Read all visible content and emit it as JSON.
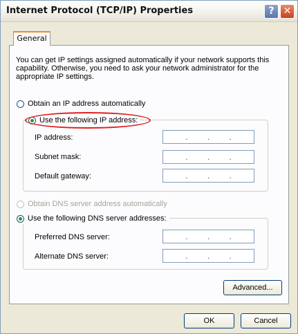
{
  "window": {
    "title": "Internet Protocol (TCP/IP) Properties",
    "help_symbol": "?",
    "close_symbol": "✕"
  },
  "tabs": [
    {
      "label": "General"
    }
  ],
  "intro_text": "You can get IP settings assigned automatically if your network supports this capability. Otherwise, you need to ask your network administrator for the appropriate IP settings.",
  "ip_options": {
    "auto": {
      "label": "Obtain an IP address automatically",
      "checked": false
    },
    "manual": {
      "label": "Use the following IP address:",
      "checked": true
    }
  },
  "ip_fields": [
    {
      "label": "IP address:",
      "value": ". . ."
    },
    {
      "label": "Subnet mask:",
      "value": ". . ."
    },
    {
      "label": "Default gateway:",
      "value": ". . ."
    }
  ],
  "dns_options": {
    "auto": {
      "label": "Obtain DNS server address automatically",
      "checked": false,
      "disabled": true
    },
    "manual": {
      "label": "Use the following DNS server addresses:",
      "checked": true
    }
  },
  "dns_fields": [
    {
      "label": "Preferred DNS server:",
      "value": ". . ."
    },
    {
      "label": "Alternate DNS server:",
      "value": ". . ."
    }
  ],
  "buttons": {
    "advanced": "Advanced...",
    "ok": "OK",
    "cancel": "Cancel"
  },
  "colors": {
    "highlight_ellipse": "#e02020",
    "tab_accent": "#e68b2c"
  }
}
